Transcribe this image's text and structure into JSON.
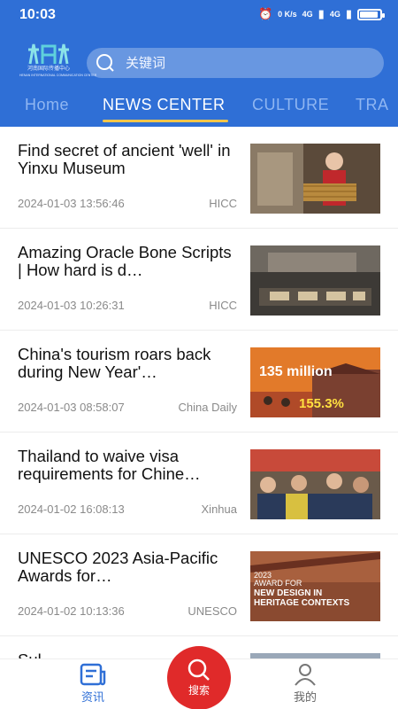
{
  "status_bar": {
    "time": "10:03",
    "net_speed": "0 K/s",
    "signal_1": "4G",
    "signal_2": "4G",
    "battery_level": 0.85
  },
  "header": {
    "logo_name": "河南国际传播中心",
    "logo_subtitle": "HENAN INTERNATIONAL COMMUNICATION CENTER",
    "search_placeholder": "关键词",
    "accent_color": "#2f6fd6"
  },
  "tabs": [
    {
      "label": "Home",
      "active": false
    },
    {
      "label": "NEWS CENTER",
      "active": true
    },
    {
      "label": "CULTURE",
      "active": false
    },
    {
      "label": "TRA",
      "active": false
    }
  ],
  "news": [
    {
      "title": "Find secret of ancient 'well' in Yinxu Museum",
      "date": "2024-01-03 13:56:46",
      "source": "HICC"
    },
    {
      "title": "Amazing Oracle Bone Scripts | How hard is d…",
      "date": "2024-01-03 10:26:31",
      "source": "HICC"
    },
    {
      "title": "China's tourism roars back during New Year'…",
      "date": "2024-01-03 08:58:07",
      "source": "China Daily",
      "thumb_text": [
        "135 million",
        "155.3%"
      ]
    },
    {
      "title": "Thailand to waive visa requirements for Chine…",
      "date": "2024-01-02 16:08:13",
      "source": "Xinhua"
    },
    {
      "title": "UNESCO 2023 Asia-Pacific Awards for…",
      "date": "2024-01-02 10:13:36",
      "source": "UNESCO",
      "thumb_text": [
        "2023",
        "AWARD FOR",
        "NEW DESIGN IN",
        "HERITAGE CONTEXTS"
      ]
    },
    {
      "title": "Sul…"
    }
  ],
  "bottom_nav": {
    "news_label": "资讯",
    "search_label": "搜索",
    "me_label": "我的",
    "search_color": "#e02a2a"
  }
}
